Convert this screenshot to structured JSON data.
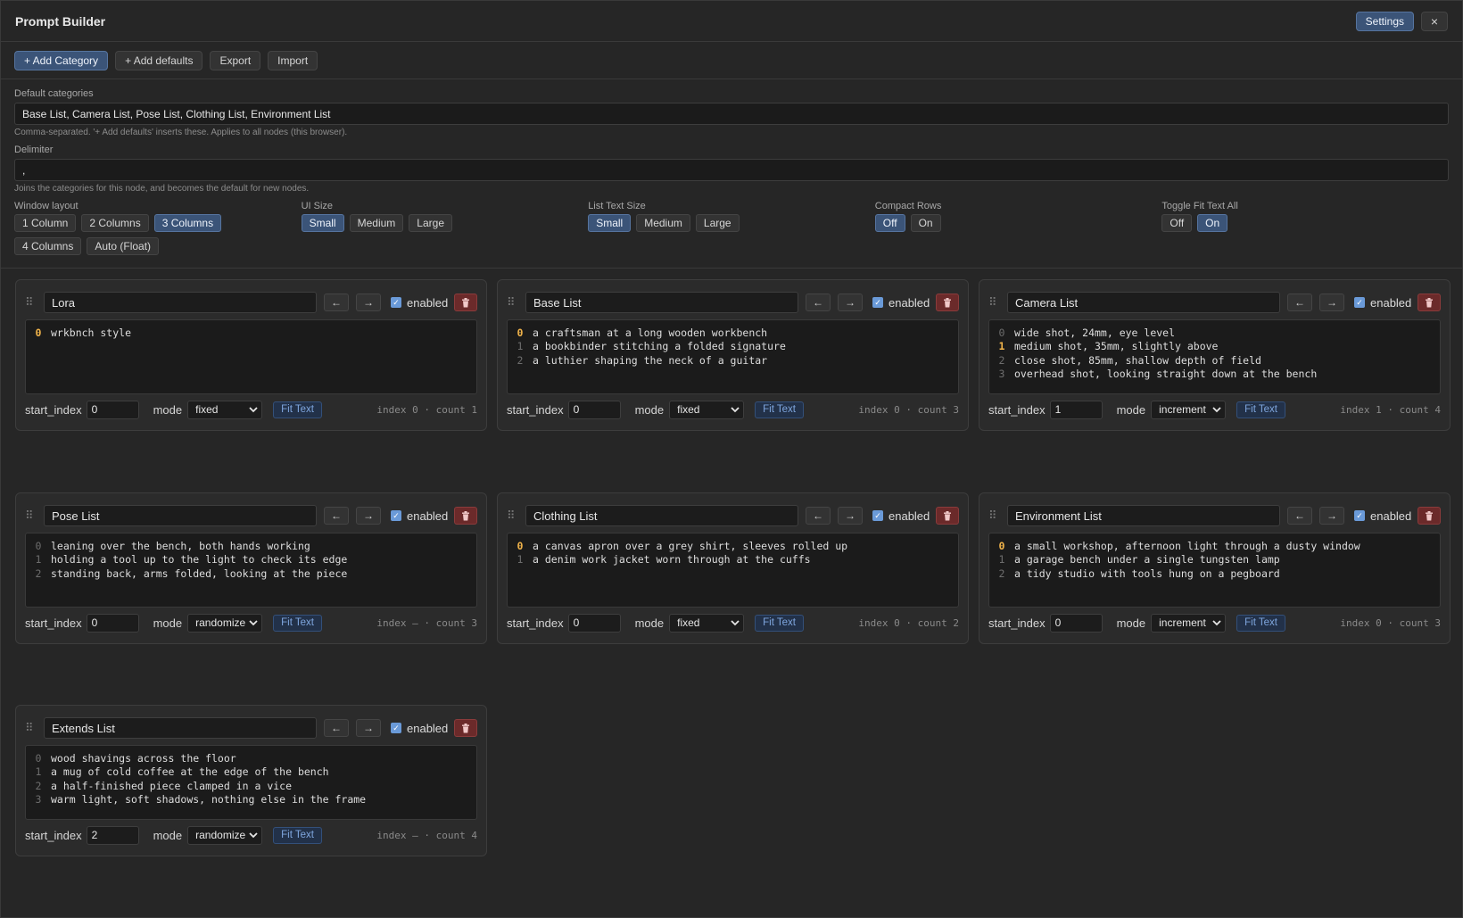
{
  "window": {
    "title": "Prompt Builder",
    "settings_label": "Settings",
    "close_label": "×"
  },
  "toolbar": {
    "add_category": "+ Add Category",
    "add_defaults": "+ Add defaults",
    "export": "Export",
    "import": "Import"
  },
  "settings": {
    "default_categories_label": "Default categories",
    "default_categories_value": "Base List, Camera List, Pose List, Clothing List, Environment List",
    "default_categories_hint": "Comma-separated. '+ Add defaults' inserts these. Applies to all nodes (this browser).",
    "delimiter_label": "Delimiter",
    "delimiter_value": ",",
    "delimiter_hint": "Joins the categories for this node, and becomes the default for new nodes.",
    "window_layout": {
      "label": "Window layout",
      "options": [
        "1 Column",
        "2 Columns",
        "3 Columns",
        "4 Columns",
        "Auto (Float)"
      ],
      "selected": "3 Columns"
    },
    "ui_size": {
      "label": "UI Size",
      "options": [
        "Small",
        "Medium",
        "Large"
      ],
      "selected": "Small"
    },
    "list_text_size": {
      "label": "List Text Size",
      "options": [
        "Small",
        "Medium",
        "Large"
      ],
      "selected": "Small"
    },
    "compact_rows": {
      "label": "Compact Rows",
      "options": [
        "Off",
        "On"
      ],
      "selected": "Off"
    },
    "toggle_fit_text_all": {
      "label": "Toggle Fit Text All",
      "options": [
        "Off",
        "On"
      ],
      "selected": "On"
    }
  },
  "labels": {
    "prev_arrow": "←",
    "next_arrow": "→",
    "enabled": "enabled",
    "start_index": "start_index",
    "mode": "mode",
    "fit_text": "Fit Text"
  },
  "cards": [
    {
      "name": "Lora",
      "enabled": true,
      "lines": [
        "wrkbnch style"
      ],
      "current": 0,
      "start_index": "0",
      "mode": "fixed",
      "stats": "index 0 · count 1"
    },
    {
      "name": "Base List",
      "enabled": true,
      "lines": [
        "a craftsman at a long wooden workbench",
        "a bookbinder stitching a folded signature",
        "a luthier shaping the neck of a guitar"
      ],
      "current": 0,
      "start_index": "0",
      "mode": "fixed",
      "stats": "index 0 · count 3"
    },
    {
      "name": "Camera List",
      "enabled": true,
      "lines": [
        "wide shot, 24mm, eye level",
        "medium shot, 35mm, slightly above",
        "close shot, 85mm, shallow depth of field",
        "overhead shot, looking straight down at the bench"
      ],
      "current": 1,
      "start_index": "1",
      "mode": "increment",
      "stats": "index 1 · count 4"
    },
    {
      "name": "Pose List",
      "enabled": true,
      "lines": [
        "leaning over the bench, both hands working",
        "holding a tool up to the light to check its edge",
        "standing back, arms folded, looking at the piece"
      ],
      "current": -1,
      "start_index": "0",
      "mode": "randomize",
      "stats": "index – · count 3"
    },
    {
      "name": "Clothing List",
      "enabled": true,
      "lines": [
        "a canvas apron over a grey shirt, sleeves rolled up",
        "a denim work jacket worn through at the cuffs"
      ],
      "current": 0,
      "start_index": "0",
      "mode": "fixed",
      "stats": "index 0 · count 2"
    },
    {
      "name": "Environment List",
      "enabled": true,
      "lines": [
        "a small workshop, afternoon light through a dusty window",
        "a garage bench under a single tungsten lamp",
        "a tidy studio with tools hung on a pegboard"
      ],
      "current": 0,
      "start_index": "0",
      "mode": "increment",
      "stats": "index 0 · count 3"
    },
    {
      "name": "Extends List",
      "enabled": true,
      "lines": [
        "wood shavings across the floor",
        "a mug of cold coffee at the edge of the bench",
        "a half-finished piece clamped in a vice",
        "warm light, soft shadows, nothing else in the frame"
      ],
      "current": -1,
      "start_index": "2",
      "mode": "randomize",
      "stats": "index – · count 4"
    }
  ]
}
